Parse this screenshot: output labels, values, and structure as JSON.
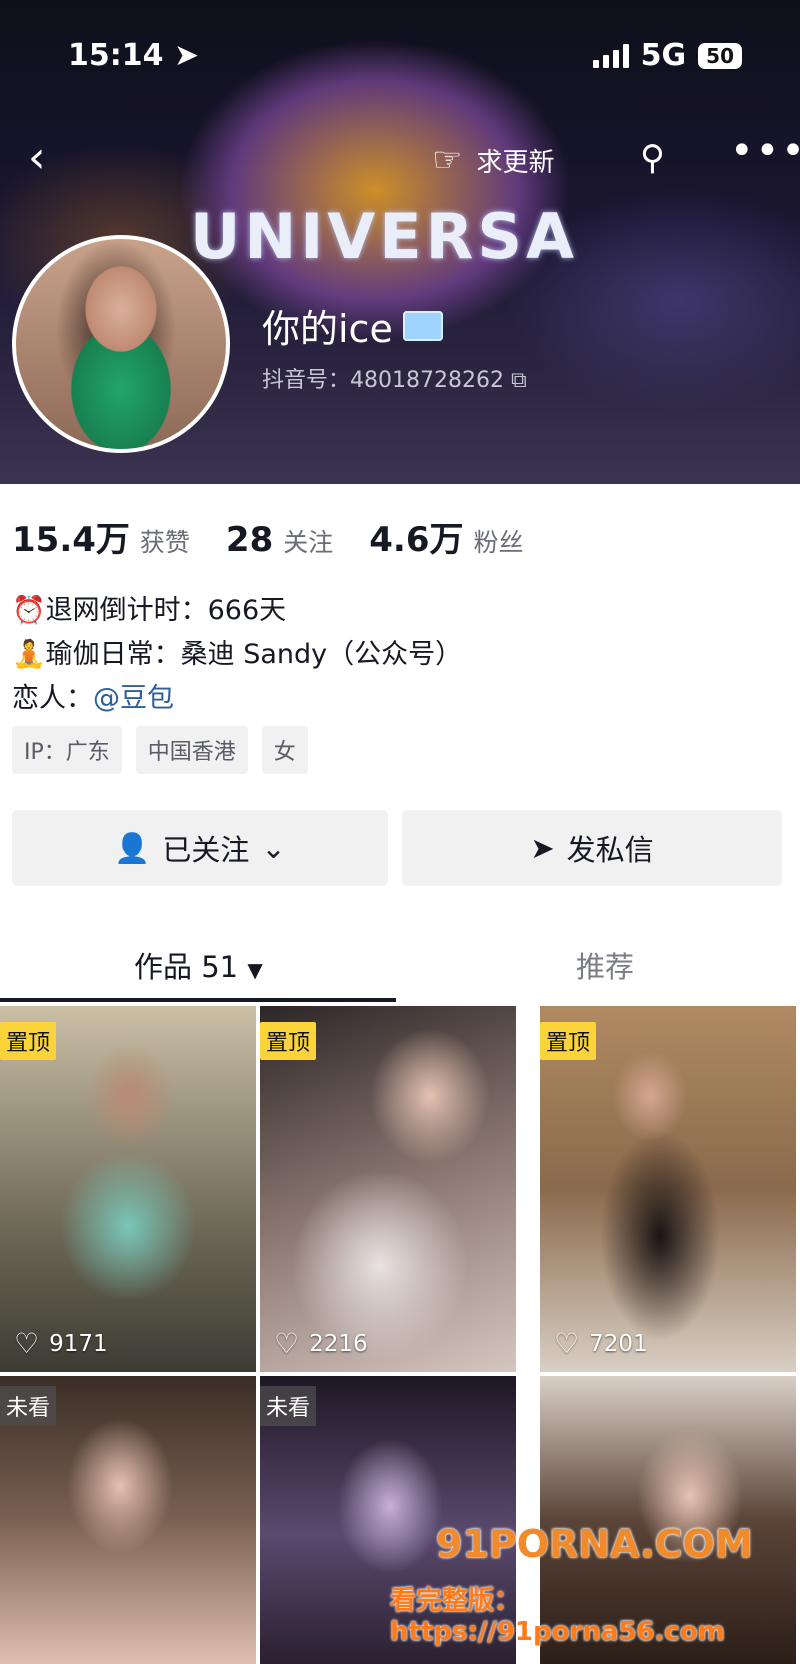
{
  "status_bar": {
    "time": "15:14",
    "network": "5G",
    "battery": "50"
  },
  "header": {
    "backdrop_sign": "UNIVERSA",
    "request_update_label": "求更新",
    "nickname": "你的ice",
    "douyin_id": "抖音号：48018728262"
  },
  "stats": [
    {
      "value": "15.4万",
      "label": "获赞"
    },
    {
      "value": "28",
      "label": "关注"
    },
    {
      "value": "4.6万",
      "label": "粉丝"
    }
  ],
  "bio": {
    "line1": "⏰退网倒计时：666天",
    "line2": "🧘瑜伽日常：桑迪 Sandy（公众号）",
    "line3_prefix": "恋人：",
    "line3_mention": "@豆包"
  },
  "tags": [
    "IP：广东",
    "中国香港",
    "女"
  ],
  "actions": {
    "follow_label": "已关注",
    "dm_label": "发私信"
  },
  "tabs": {
    "works_label": "作品 51",
    "recommend_label": "推荐"
  },
  "videos": [
    {
      "badge": "置顶",
      "likes": "9171"
    },
    {
      "badge": "置顶",
      "likes": "2216"
    },
    {
      "badge": "置顶",
      "likes": "7201"
    },
    {
      "badge": "未看",
      "likes": ""
    },
    {
      "badge": "未看",
      "likes": ""
    },
    {
      "badge": "",
      "likes": ""
    }
  ],
  "watermark": {
    "site": "91PORNA.COM",
    "line2": "看完整版：https://91porna56.com"
  },
  "colors": {
    "pin_badge": "#fcd43a",
    "mention": "#2c5e9e",
    "watermark": "#f08a2a"
  },
  "icons": [
    "location-arrow-icon",
    "signal-icon",
    "back-icon",
    "hand-point-icon",
    "search-icon",
    "more-icon",
    "follow-user-icon",
    "chevron-down-icon",
    "send-icon",
    "dropdown-triangle-icon",
    "heart-icon",
    "ice-emoji-icon",
    "copy-icon"
  ]
}
